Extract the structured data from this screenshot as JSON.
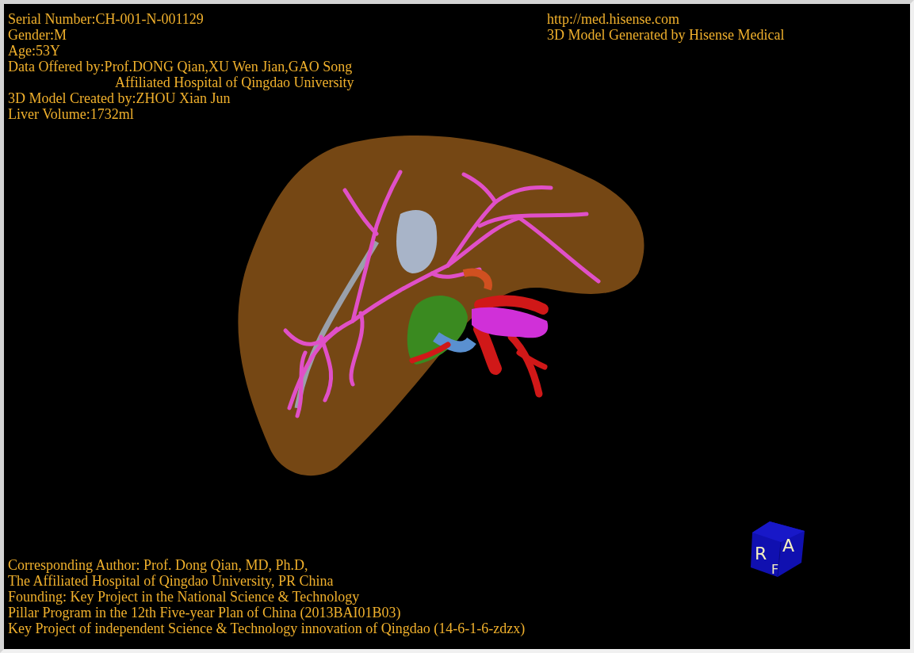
{
  "info_lines": [
    {
      "kind": "line",
      "text": "Serial Number:CH-001-N-001129"
    },
    {
      "kind": "line",
      "text": "Gender:M"
    },
    {
      "kind": "line",
      "text": "Age:53Y"
    },
    {
      "kind": "line",
      "text": "Data Offered by:Prof.DONG Qian,XU Wen Jian,GAO Song"
    },
    {
      "kind": "continuation",
      "text": "Affiliated Hospital of Qingdao University"
    },
    {
      "kind": "line",
      "text": "3D Model Created by:ZHOU Xian Jun"
    },
    {
      "kind": "line",
      "text": "Liver Volume:1732ml"
    }
  ],
  "brand_lines": [
    "http://med.hisense.com",
    "3D Model Generated by Hisense Medical"
  ],
  "credit_lines": [
    "Corresponding Author: Prof. Dong Qian, MD, Ph.D,",
    "The Affiliated Hospital of Qingdao University, PR China",
    "Founding: Key Project in the National Science & Technology",
    "Pillar Program in the 12th Five-year Plan of China (2013BAI01B03)",
    "Key Project of independent Science & Technology innovation of Qingdao (14-6-1-6-zdzx)"
  ],
  "orientation_cube": {
    "labels": [
      "R",
      "A",
      "F"
    ]
  }
}
